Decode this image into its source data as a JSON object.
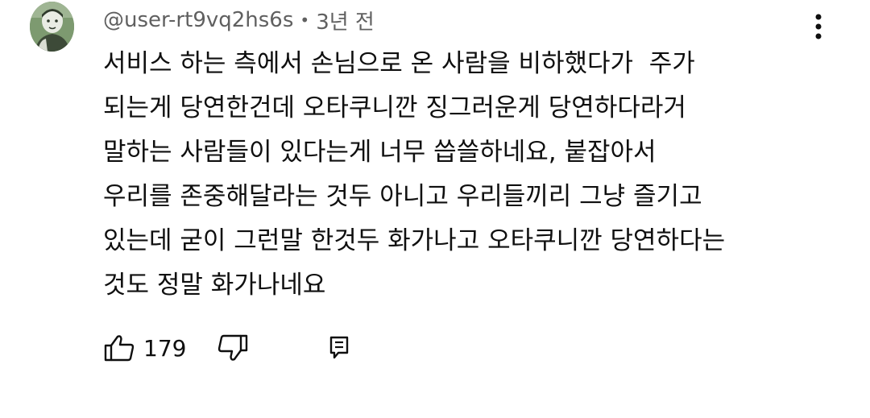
{
  "comment": {
    "author": "@user-rt9vq2hs6s",
    "separator": "•",
    "time": "3년 전",
    "text_lines": [
      "서비스 하는 측에서 손님으로 온 사람을 비하했다가  주가",
      "되는게 당연한건데 오타쿠니깐 징그러운게 당연하다라거",
      "말하는 사람들이 있다는게 너무 씁쓸하네요, 붙잡아서",
      "우리를 존중해달라는 것두 아니고 우리들끼리 그냥 즐기고",
      "있는데 굳이 그런말 한것두 화가나고 오타쿠니깐 당연하다는",
      "것도 정말 화가나네요"
    ],
    "like_count": "179"
  },
  "icons": {
    "avatar": "avatar-image",
    "more": "more-vertical-icon",
    "like": "thumb-up-icon",
    "dislike": "thumb-down-icon",
    "reply": "reply-comment-icon"
  },
  "colors": {
    "text": "#0f0f0f",
    "meta": "#606060",
    "avatar_bg": "#6f8a63"
  }
}
